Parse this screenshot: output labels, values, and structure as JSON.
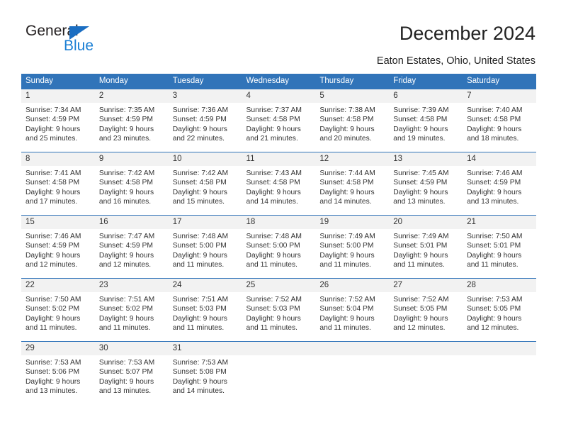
{
  "brand": {
    "name_part1": "General",
    "name_part2": "Blue",
    "triangle_icon": "blue-triangle-logo-mark"
  },
  "header": {
    "title": "December 2024",
    "subtitle": "Eaton Estates, Ohio, United States"
  },
  "colors": {
    "header_blue": "#3174b9",
    "logo_blue": "#1b7fd4",
    "daynum_band": "#f2f2f2",
    "text": "#333333"
  },
  "calendar": {
    "weekday_headers": [
      "Sunday",
      "Monday",
      "Tuesday",
      "Wednesday",
      "Thursday",
      "Friday",
      "Saturday"
    ],
    "labels": {
      "sunrise_prefix": "Sunrise:",
      "sunset_prefix": "Sunset:",
      "daylight_prefix": "Daylight:"
    },
    "weeks": [
      [
        {
          "day": "1",
          "sunrise": "Sunrise: 7:34 AM",
          "sunset": "Sunset: 4:59 PM",
          "daylight_line1": "Daylight: 9 hours",
          "daylight_line2": "and 25 minutes."
        },
        {
          "day": "2",
          "sunrise": "Sunrise: 7:35 AM",
          "sunset": "Sunset: 4:59 PM",
          "daylight_line1": "Daylight: 9 hours",
          "daylight_line2": "and 23 minutes."
        },
        {
          "day": "3",
          "sunrise": "Sunrise: 7:36 AM",
          "sunset": "Sunset: 4:59 PM",
          "daylight_line1": "Daylight: 9 hours",
          "daylight_line2": "and 22 minutes."
        },
        {
          "day": "4",
          "sunrise": "Sunrise: 7:37 AM",
          "sunset": "Sunset: 4:58 PM",
          "daylight_line1": "Daylight: 9 hours",
          "daylight_line2": "and 21 minutes."
        },
        {
          "day": "5",
          "sunrise": "Sunrise: 7:38 AM",
          "sunset": "Sunset: 4:58 PM",
          "daylight_line1": "Daylight: 9 hours",
          "daylight_line2": "and 20 minutes."
        },
        {
          "day": "6",
          "sunrise": "Sunrise: 7:39 AM",
          "sunset": "Sunset: 4:58 PM",
          "daylight_line1": "Daylight: 9 hours",
          "daylight_line2": "and 19 minutes."
        },
        {
          "day": "7",
          "sunrise": "Sunrise: 7:40 AM",
          "sunset": "Sunset: 4:58 PM",
          "daylight_line1": "Daylight: 9 hours",
          "daylight_line2": "and 18 minutes."
        }
      ],
      [
        {
          "day": "8",
          "sunrise": "Sunrise: 7:41 AM",
          "sunset": "Sunset: 4:58 PM",
          "daylight_line1": "Daylight: 9 hours",
          "daylight_line2": "and 17 minutes."
        },
        {
          "day": "9",
          "sunrise": "Sunrise: 7:42 AM",
          "sunset": "Sunset: 4:58 PM",
          "daylight_line1": "Daylight: 9 hours",
          "daylight_line2": "and 16 minutes."
        },
        {
          "day": "10",
          "sunrise": "Sunrise: 7:42 AM",
          "sunset": "Sunset: 4:58 PM",
          "daylight_line1": "Daylight: 9 hours",
          "daylight_line2": "and 15 minutes."
        },
        {
          "day": "11",
          "sunrise": "Sunrise: 7:43 AM",
          "sunset": "Sunset: 4:58 PM",
          "daylight_line1": "Daylight: 9 hours",
          "daylight_line2": "and 14 minutes."
        },
        {
          "day": "12",
          "sunrise": "Sunrise: 7:44 AM",
          "sunset": "Sunset: 4:58 PM",
          "daylight_line1": "Daylight: 9 hours",
          "daylight_line2": "and 14 minutes."
        },
        {
          "day": "13",
          "sunrise": "Sunrise: 7:45 AM",
          "sunset": "Sunset: 4:59 PM",
          "daylight_line1": "Daylight: 9 hours",
          "daylight_line2": "and 13 minutes."
        },
        {
          "day": "14",
          "sunrise": "Sunrise: 7:46 AM",
          "sunset": "Sunset: 4:59 PM",
          "daylight_line1": "Daylight: 9 hours",
          "daylight_line2": "and 13 minutes."
        }
      ],
      [
        {
          "day": "15",
          "sunrise": "Sunrise: 7:46 AM",
          "sunset": "Sunset: 4:59 PM",
          "daylight_line1": "Daylight: 9 hours",
          "daylight_line2": "and 12 minutes."
        },
        {
          "day": "16",
          "sunrise": "Sunrise: 7:47 AM",
          "sunset": "Sunset: 4:59 PM",
          "daylight_line1": "Daylight: 9 hours",
          "daylight_line2": "and 12 minutes."
        },
        {
          "day": "17",
          "sunrise": "Sunrise: 7:48 AM",
          "sunset": "Sunset: 5:00 PM",
          "daylight_line1": "Daylight: 9 hours",
          "daylight_line2": "and 11 minutes."
        },
        {
          "day": "18",
          "sunrise": "Sunrise: 7:48 AM",
          "sunset": "Sunset: 5:00 PM",
          "daylight_line1": "Daylight: 9 hours",
          "daylight_line2": "and 11 minutes."
        },
        {
          "day": "19",
          "sunrise": "Sunrise: 7:49 AM",
          "sunset": "Sunset: 5:00 PM",
          "daylight_line1": "Daylight: 9 hours",
          "daylight_line2": "and 11 minutes."
        },
        {
          "day": "20",
          "sunrise": "Sunrise: 7:49 AM",
          "sunset": "Sunset: 5:01 PM",
          "daylight_line1": "Daylight: 9 hours",
          "daylight_line2": "and 11 minutes."
        },
        {
          "day": "21",
          "sunrise": "Sunrise: 7:50 AM",
          "sunset": "Sunset: 5:01 PM",
          "daylight_line1": "Daylight: 9 hours",
          "daylight_line2": "and 11 minutes."
        }
      ],
      [
        {
          "day": "22",
          "sunrise": "Sunrise: 7:50 AM",
          "sunset": "Sunset: 5:02 PM",
          "daylight_line1": "Daylight: 9 hours",
          "daylight_line2": "and 11 minutes."
        },
        {
          "day": "23",
          "sunrise": "Sunrise: 7:51 AM",
          "sunset": "Sunset: 5:02 PM",
          "daylight_line1": "Daylight: 9 hours",
          "daylight_line2": "and 11 minutes."
        },
        {
          "day": "24",
          "sunrise": "Sunrise: 7:51 AM",
          "sunset": "Sunset: 5:03 PM",
          "daylight_line1": "Daylight: 9 hours",
          "daylight_line2": "and 11 minutes."
        },
        {
          "day": "25",
          "sunrise": "Sunrise: 7:52 AM",
          "sunset": "Sunset: 5:03 PM",
          "daylight_line1": "Daylight: 9 hours",
          "daylight_line2": "and 11 minutes."
        },
        {
          "day": "26",
          "sunrise": "Sunrise: 7:52 AM",
          "sunset": "Sunset: 5:04 PM",
          "daylight_line1": "Daylight: 9 hours",
          "daylight_line2": "and 11 minutes."
        },
        {
          "day": "27",
          "sunrise": "Sunrise: 7:52 AM",
          "sunset": "Sunset: 5:05 PM",
          "daylight_line1": "Daylight: 9 hours",
          "daylight_line2": "and 12 minutes."
        },
        {
          "day": "28",
          "sunrise": "Sunrise: 7:53 AM",
          "sunset": "Sunset: 5:05 PM",
          "daylight_line1": "Daylight: 9 hours",
          "daylight_line2": "and 12 minutes."
        }
      ],
      [
        {
          "day": "29",
          "sunrise": "Sunrise: 7:53 AM",
          "sunset": "Sunset: 5:06 PM",
          "daylight_line1": "Daylight: 9 hours",
          "daylight_line2": "and 13 minutes."
        },
        {
          "day": "30",
          "sunrise": "Sunrise: 7:53 AM",
          "sunset": "Sunset: 5:07 PM",
          "daylight_line1": "Daylight: 9 hours",
          "daylight_line2": "and 13 minutes."
        },
        {
          "day": "31",
          "sunrise": "Sunrise: 7:53 AM",
          "sunset": "Sunset: 5:08 PM",
          "daylight_line1": "Daylight: 9 hours",
          "daylight_line2": "and 14 minutes."
        },
        {
          "day": "",
          "sunrise": "",
          "sunset": "",
          "daylight_line1": "",
          "daylight_line2": ""
        },
        {
          "day": "",
          "sunrise": "",
          "sunset": "",
          "daylight_line1": "",
          "daylight_line2": ""
        },
        {
          "day": "",
          "sunrise": "",
          "sunset": "",
          "daylight_line1": "",
          "daylight_line2": ""
        },
        {
          "day": "",
          "sunrise": "",
          "sunset": "",
          "daylight_line1": "",
          "daylight_line2": ""
        }
      ]
    ]
  }
}
